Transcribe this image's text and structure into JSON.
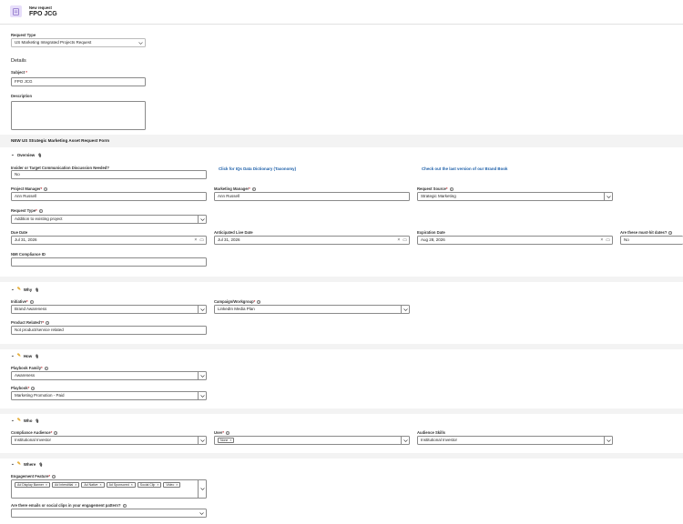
{
  "header": {
    "subtitle": "New request",
    "title": "FPO JCG"
  },
  "request_type": {
    "label": "Request Type",
    "value": "US Marketing Integrated Projects Request"
  },
  "details": {
    "heading": "Details",
    "subject_label": "Subject",
    "subject_value": "FPO JCG",
    "description_label": "Description"
  },
  "form_title": "NEW US Strategic Marketing Asset Request Form",
  "overview": {
    "heading": "Overview",
    "icon": "🎙",
    "insider_label": "Insider or Target Communication Discussion Needed?",
    "insider_value": "No",
    "link1": "Click for IQs Data Dictionary (Taxonomy)",
    "link2": "Check out the last version of our Brand Book",
    "pm_label": "Project Manager",
    "pm_value": "Ann Russell",
    "mm_label": "Marketing Manager",
    "mm_value": "Ann Russell",
    "rs_label": "Request Source",
    "rs_value": "Strategic Marketing",
    "rt_label": "Request Type",
    "rt_value": "Addition to existing project",
    "due_label": "Due Date",
    "due_value": "Jul 31, 2026",
    "live_label": "Anticipated Live Date",
    "live_value": "Jul 31, 2026",
    "exp_label": "Expiration Date",
    "exp_value": "Aug 28, 2026",
    "fixed_label": "Are these must-hit dates?",
    "fixed_value": "No",
    "nmi_label": "NMI Compliance ID"
  },
  "why": {
    "heading": "Why",
    "initiative_label": "Initiative",
    "initiative_value": "Brand Awareness",
    "campaign_label": "Campaign/Workgroup",
    "campaign_value": "LinkedIn Media Plan",
    "product_label": "Product Related?",
    "product_value": "Not product/service related"
  },
  "how": {
    "heading": "How",
    "family_label": "Playbook Family",
    "family_value": "Awareness",
    "playbook_label": "Playbook",
    "playbook_value": "Marketing Promotion - Paid"
  },
  "who": {
    "heading": "Who",
    "audience_label": "Compliance Audience",
    "audience_value": "Institutional Investor",
    "user_label": "User",
    "user_tag": "None",
    "skills_label": "Audience Skills",
    "skills_value": "Institutional Investor"
  },
  "where": {
    "heading": "Where",
    "features_label": "Engagement Feature",
    "tags": [
      "Ad Display Banner",
      "Ad Interstitial",
      "Ad Native",
      "Ad Sponsored",
      "Social Clip",
      "Video"
    ],
    "social_label": "Are there emails or social clips in your engagement pattern?"
  },
  "colors": {
    "accent": "#1b5ea8",
    "required": "#c4262e",
    "header_icon": "#8a6fc7"
  }
}
